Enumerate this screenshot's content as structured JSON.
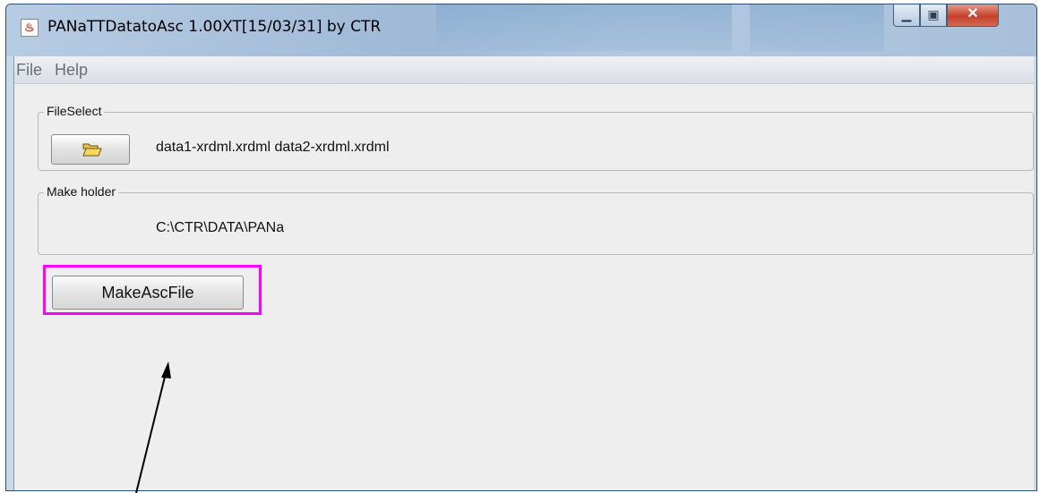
{
  "window": {
    "title": "PANaTTDatatoAsc 1.00XT[15/03/31] by CTR",
    "controls": {
      "minimize_icon": "minimize-icon",
      "maximize_icon": "maximize-icon",
      "close_icon": "close-icon"
    }
  },
  "menu": {
    "items": [
      "File",
      "Help"
    ]
  },
  "file_select": {
    "title": "FileSelect",
    "open_icon": "folder-open-icon",
    "files": "data1-xrdml.xrdml  data2-xrdml.xrdml"
  },
  "make_holder": {
    "title": "Make holder",
    "path": "C:\\CTR\\DATA\\PANa"
  },
  "actions": {
    "make_label": "MakeAscFile"
  },
  "annotation": {
    "highlight_color": "#ff00ff",
    "arrow_color": "#000000"
  }
}
